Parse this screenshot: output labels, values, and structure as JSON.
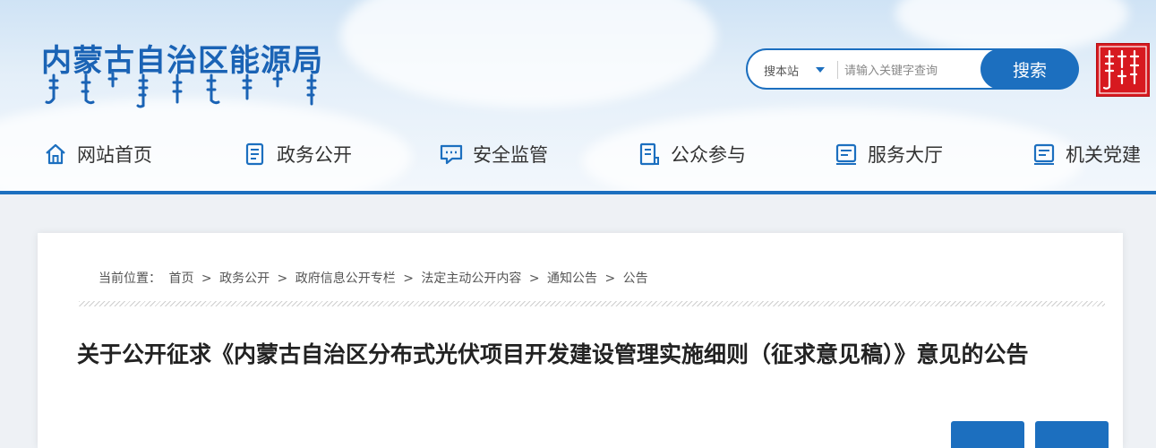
{
  "site": {
    "title": "内蒙古自治区能源局",
    "mongolian_subtitle_icon": "mongolian-script-graphic",
    "seal_icon": "red-mongolian-seal"
  },
  "search": {
    "scope": "搜本站",
    "placeholder": "请输入关键字查询",
    "button": "搜索"
  },
  "nav": [
    {
      "label": "网站首页",
      "icon": "home-icon"
    },
    {
      "label": "政务公开",
      "icon": "document-list-icon"
    },
    {
      "label": "安全监管",
      "icon": "chat-bubble-icon"
    },
    {
      "label": "公众参与",
      "icon": "clipboard-icon"
    },
    {
      "label": "服务大厅",
      "icon": "service-panel-icon"
    },
    {
      "label": "机关党建",
      "icon": "party-building-icon"
    }
  ],
  "breadcrumb": {
    "prefix": "当前位置：",
    "items": [
      "首页",
      "政务公开",
      "政府信息公开专栏",
      "法定主动公开内容",
      "通知公告",
      "公告"
    ],
    "separator": ">"
  },
  "article": {
    "title": "关于公开征求《内蒙古自治区分布式光伏项目开发建设管理实施细则（征求意见稿）》意见的公告"
  },
  "colors": {
    "brand_blue": "#1c6fbf",
    "seal_red": "#d7191f"
  }
}
